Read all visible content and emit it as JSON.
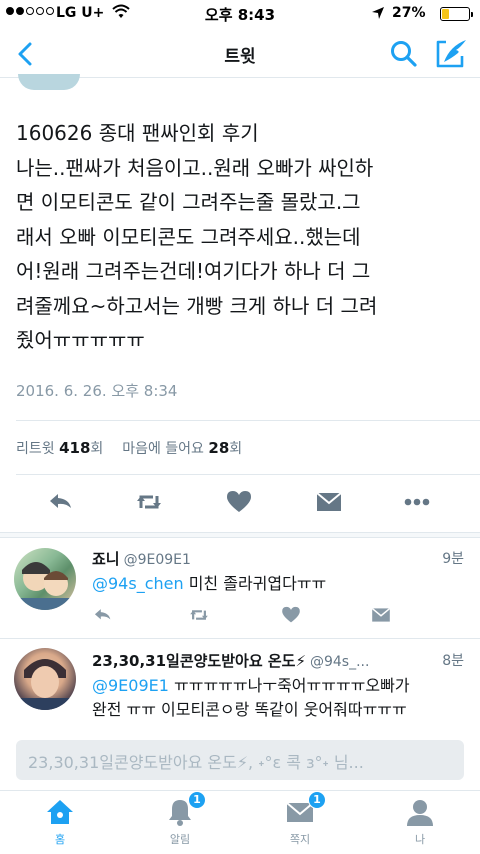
{
  "status_bar": {
    "carrier": "LG U+",
    "time": "오후 8:43",
    "battery": "27%",
    "battery_level": 0.27
  },
  "nav": {
    "title": "트윗",
    "icons": [
      "back-chevron-icon",
      "search-icon",
      "compose-icon"
    ]
  },
  "tweet": {
    "lines": [
      "160626 종대 팬싸인회 후기",
      "나는..팬싸가 처음이고..원래 오빠가 싸인하",
      "면 이모티콘도 같이 그려주는줄 몰랐고.그",
      "래서 오빠 이모티콘도 그려주세요..했는데",
      "어!원래 그려주는건데!여기다가 하나 더 그",
      "려줄께요~하고서는 개빵 크게 하나 더 그려",
      "줬어ㅠㅠㅠㅠㅠ"
    ],
    "timestamp": "2016. 6. 26. 오후 8:34",
    "retweet_label": "리트윗",
    "retweet_count": "418",
    "retweet_unit": "회",
    "like_label": "마음에 들어요",
    "like_count": "28",
    "like_unit": "회"
  },
  "replies": [
    {
      "name": "죠니",
      "handle": "@9E09E1",
      "ago": "9분",
      "mention": "@94s_chen",
      "text": " 미친 졸라귀엽다ㅠㅠ"
    },
    {
      "name": "23,30,31일콘양도받아요 온도⚡",
      "handle": "@94s_...",
      "ago": "8분",
      "mention": "@9E09E1",
      "text": " ㅠㅠㅠㅠㅠ나ㅜ죽어ㅠㅠㅠㅠ오빠가",
      "text2": "완전 ㅠㅠ  이모티콘ㅇ랑 똑같이 웃어줘따ㅠㅠㅠ"
    }
  ],
  "reply_box": {
    "placeholder": "23,30,31일콘양도받아요 온도⚡, ˖°ε 콕 з°˖ 님..."
  },
  "tabs": [
    {
      "label": "홈",
      "icon": "home-icon",
      "badge": ""
    },
    {
      "label": "알림",
      "icon": "bell-icon",
      "badge": "1"
    },
    {
      "label": "쪽지",
      "icon": "envelope-icon",
      "badge": "1"
    },
    {
      "label": "나",
      "icon": "person-icon",
      "badge": ""
    }
  ],
  "colors": {
    "accent": "#1da1f2",
    "muted": "#8899a6",
    "action_icon": "#657786"
  }
}
